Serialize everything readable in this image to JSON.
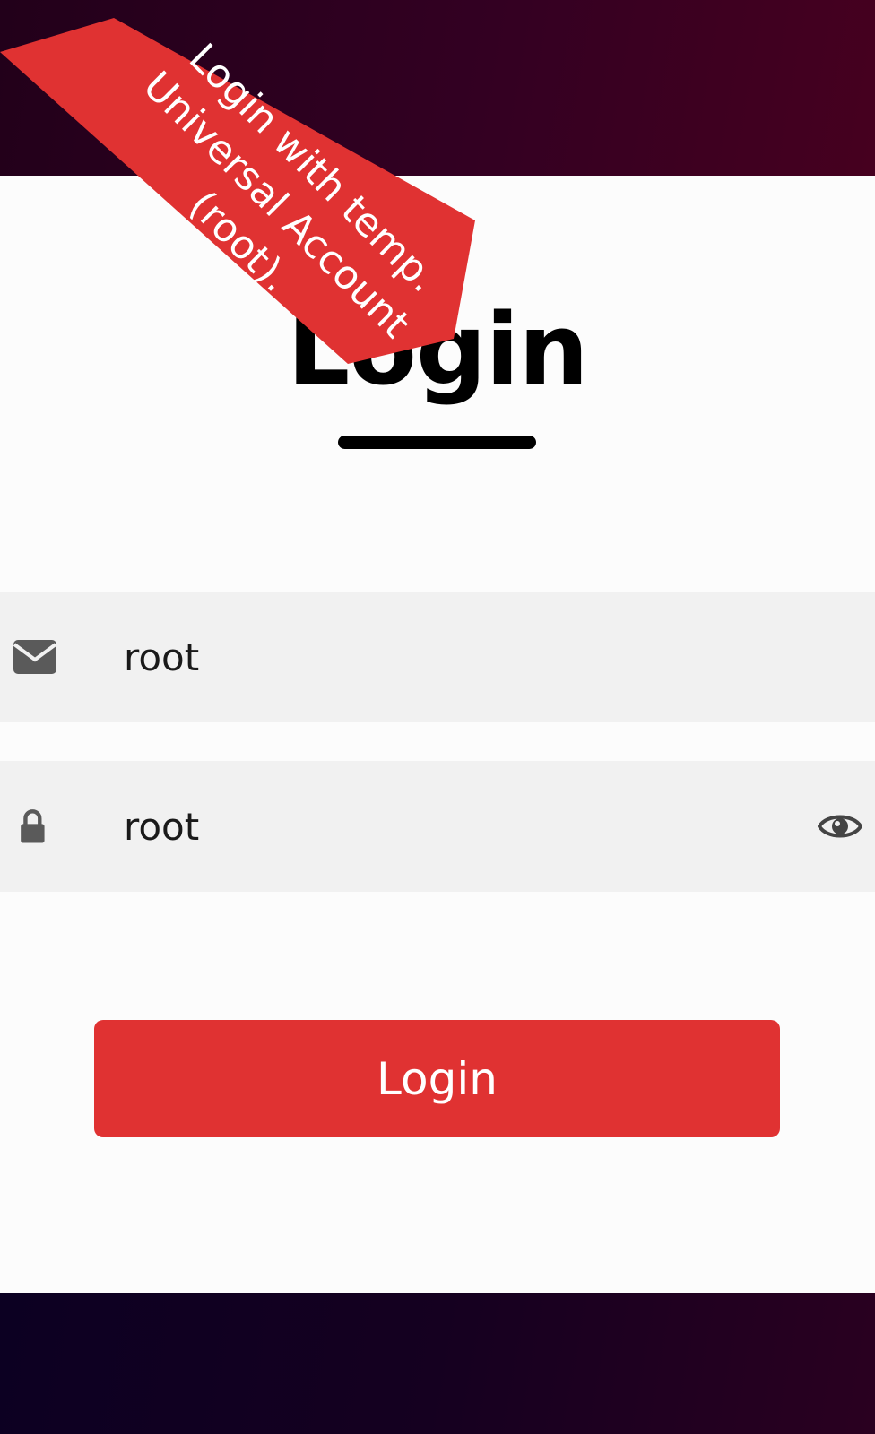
{
  "banner": {
    "line1": "Login with temp.",
    "line2": "Universal Account",
    "line3": "(root).",
    "color": "#e03232"
  },
  "form": {
    "title": "Login",
    "email": {
      "value": "root",
      "icon": "envelope-icon"
    },
    "password": {
      "value": "root",
      "icon": "lock-icon",
      "toggle_icon": "eye-icon"
    },
    "submit_label": "Login"
  },
  "colors": {
    "accent": "#e03232",
    "top_band": "#330022",
    "bottom_band": "#150020",
    "field_bg": "#f1f1f1"
  }
}
